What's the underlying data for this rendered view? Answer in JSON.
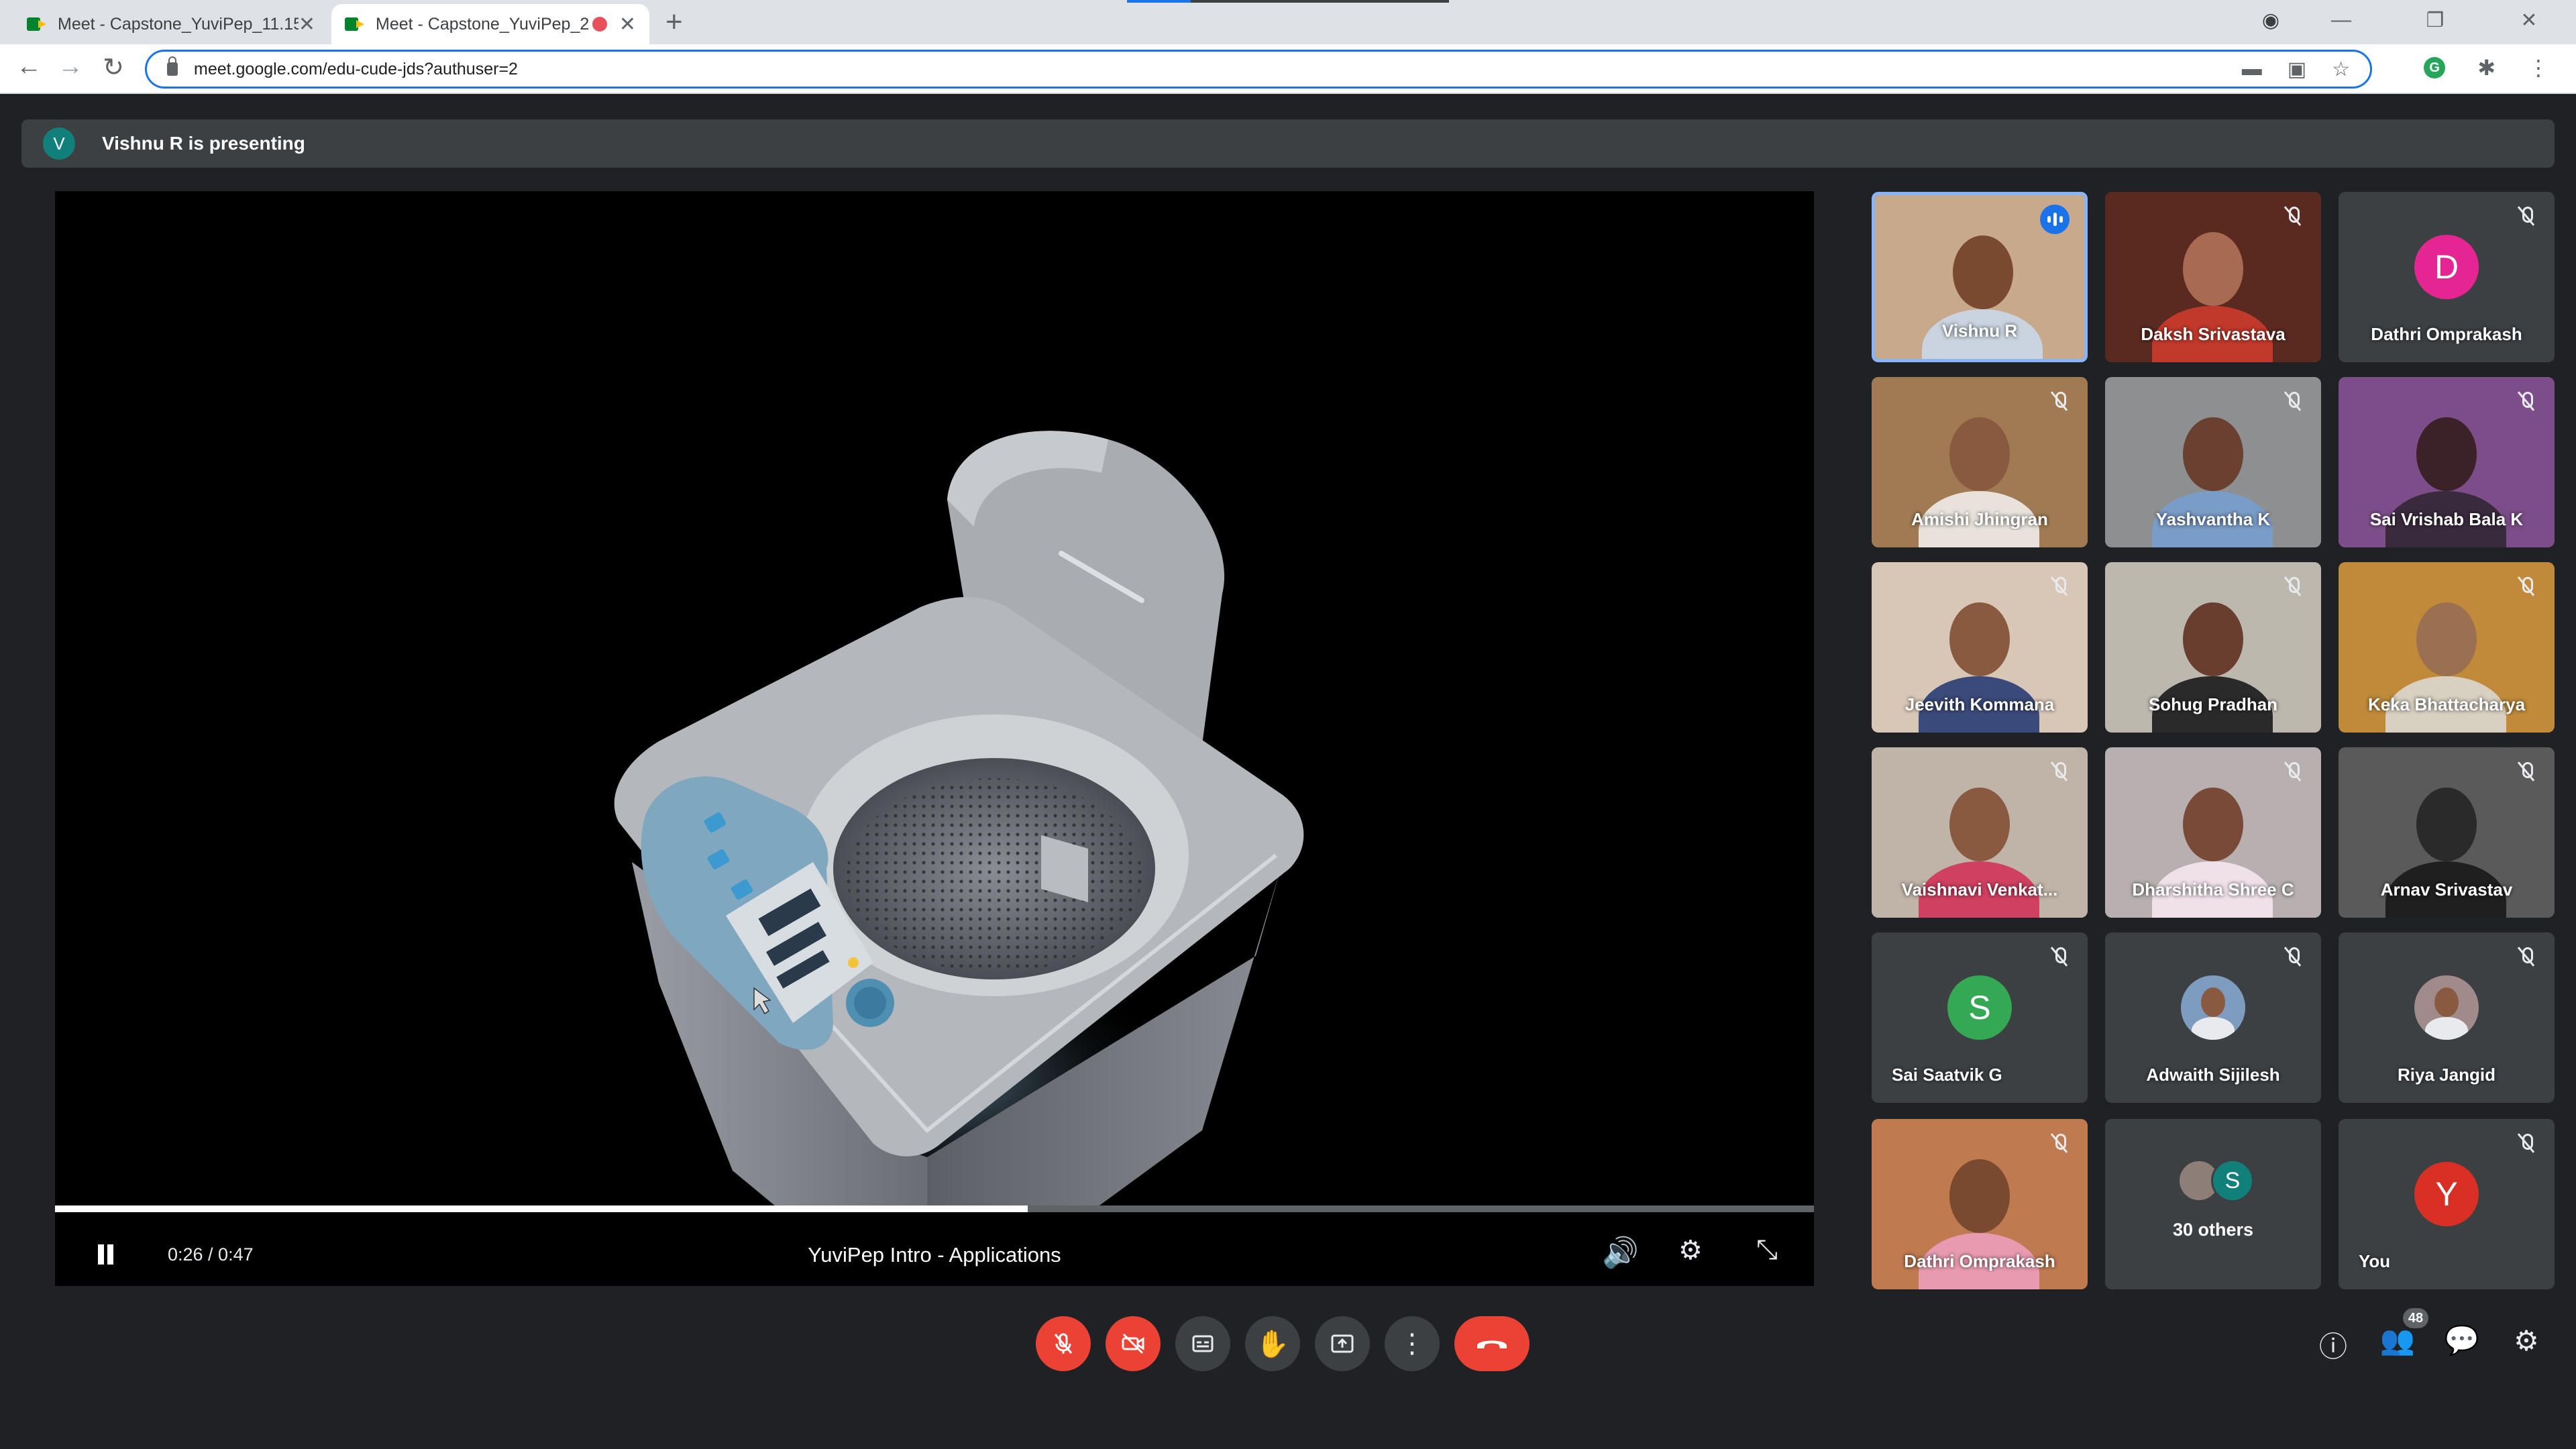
{
  "browser": {
    "tabs": [
      {
        "title": "Meet - Capstone_YuviPep_11.15",
        "active": false
      },
      {
        "title": "Meet - Capstone_YuviPep_2",
        "active": true
      }
    ],
    "url": "meet.google.com/edu-cude-jds?authuser=2"
  },
  "meet": {
    "presenting_initial": "V",
    "presenting_text": "Vishnu R is presenting",
    "video": {
      "title": "YuviPep Intro - Applications",
      "time": "0:26 / 0:47",
      "progress": 0.553
    },
    "participants": [
      {
        "name": "Vishnu R",
        "kind": "video",
        "speaking": true,
        "muted": false,
        "bg": "#c9a98b",
        "skin": "#7a4a30",
        "shirt": "#c9d4e0"
      },
      {
        "name": "Daksh Srivastava",
        "kind": "video",
        "muted": true,
        "bg": "#5a2a20",
        "skin": "#a86a50",
        "shirt": "#c0392b"
      },
      {
        "name": "Dathri Omprakash",
        "kind": "avatar",
        "muted": true,
        "initial": "D",
        "color": "#e52592"
      },
      {
        "name": "Amishi Jhingran",
        "kind": "video",
        "muted": true,
        "bg": "#a07a52",
        "skin": "#8a5a40",
        "shirt": "#e8e2da"
      },
      {
        "name": "Yashvantha K",
        "kind": "video",
        "muted": true,
        "bg": "#8d8f91",
        "skin": "#6a4030",
        "shirt": "#7a9cc8"
      },
      {
        "name": "Sai Vrishab Bala K",
        "kind": "video",
        "muted": true,
        "bg": "#7d4d8a",
        "skin": "#3a2228",
        "shirt": "#3a2a3e"
      },
      {
        "name": "Jeevith Kommana",
        "kind": "video",
        "muted": true,
        "bg": "#d8c6b6",
        "skin": "#8a5a40",
        "shirt": "#3a4a7a"
      },
      {
        "name": "Sohug Pradhan",
        "kind": "video",
        "muted": true,
        "bg": "#bcb8ae",
        "skin": "#6a3e2e",
        "shirt": "#2a2a2a"
      },
      {
        "name": "Keka Bhattacharya",
        "kind": "video",
        "muted": true,
        "bg": "#c08a3a",
        "skin": "#9a7050",
        "shirt": "#d8d0c0"
      },
      {
        "name": "Vaishnavi Venkat...",
        "kind": "video",
        "muted": true,
        "bg": "#c0b4a8",
        "skin": "#8a5a40",
        "shirt": "#d04060"
      },
      {
        "name": "Dharshitha Shree C",
        "kind": "video",
        "muted": true,
        "bg": "#b8b0b0",
        "skin": "#7a4a38",
        "shirt": "#f0e0e8"
      },
      {
        "name": "Arnav Srivastav",
        "kind": "video",
        "muted": true,
        "bg": "#5a5a5a",
        "skin": "#2a2a2a",
        "shirt": "#1f1f1f"
      },
      {
        "name": "Sai Saatvik G",
        "kind": "avatar",
        "muted": true,
        "initial": "S",
        "color": "#34a853"
      },
      {
        "name": "Adwaith Sijilesh",
        "kind": "photo-avatar",
        "muted": true,
        "color": "#7d9cc0"
      },
      {
        "name": "Riya Jangid",
        "kind": "photo-avatar",
        "muted": true,
        "color": "#a08a8a"
      },
      {
        "name": "Dathri Omprakash",
        "kind": "video",
        "muted": true,
        "bg": "#c07a50",
        "skin": "#7a4a30",
        "shirt": "#e89ab0"
      },
      {
        "name": "30 others",
        "kind": "others",
        "initial": "S"
      },
      {
        "name": "You",
        "kind": "avatar",
        "muted": true,
        "initial": "Y",
        "color": "#d93025"
      }
    ],
    "people_count": "48"
  },
  "icons": {
    "mic": "mic-off-icon",
    "camera": "camera-off-icon",
    "captions": "captions-icon",
    "hand": "raise-hand-icon",
    "present": "present-icon",
    "more": "more-vert-icon",
    "hangup": "hangup-icon",
    "info": "info-icon",
    "people": "people-icon",
    "chat": "chat-icon",
    "activities": "activities-icon"
  }
}
